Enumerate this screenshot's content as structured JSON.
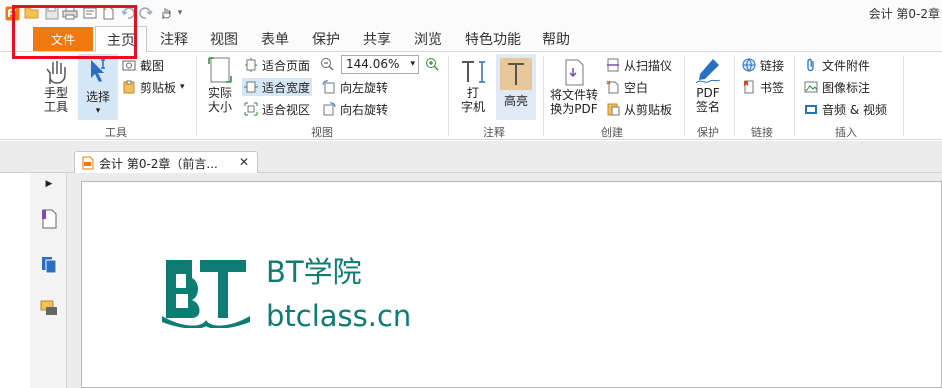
{
  "window": {
    "title": "会计 第0-2章"
  },
  "tabs": {
    "file": "文件",
    "home": "主页",
    "annotate": "注释",
    "view": "视图",
    "form": "表单",
    "protect": "保护",
    "share": "共享",
    "browse": "浏览",
    "features": "特色功能",
    "help": "帮助"
  },
  "ribbon": {
    "tools": {
      "group": "工具",
      "hand": "手型\n工具",
      "hand_l1": "手型",
      "hand_l2": "工具",
      "select": "选择",
      "screenshot": "截图",
      "clipboard": "剪贴板"
    },
    "view": {
      "group": "视图",
      "actual_l1": "实际",
      "actual_l2": "大小",
      "fit_page": "适合页面",
      "fit_width": "适合宽度",
      "fit_visible": "适合视区",
      "zoom": "144.06%",
      "rotate_left": "向左旋转",
      "rotate_right": "向右旋转"
    },
    "annotate": {
      "group": "注释",
      "typewriter_l1": "打",
      "typewriter_l2": "字机",
      "highlight": "高亮"
    },
    "create": {
      "group": "创建",
      "to_pdf_l1": "将文件转",
      "to_pdf_l2": "换为PDF",
      "from_scanner": "从扫描仪",
      "blank": "空白",
      "from_clipboard": "从剪贴板"
    },
    "protect": {
      "group": "保护",
      "sign_l1": "PDF",
      "sign_l2": "签名"
    },
    "links": {
      "group": "链接",
      "link": "链接",
      "bookmark": "书签"
    },
    "insert": {
      "group": "插入",
      "attachment": "文件附件",
      "image": "图像标注",
      "audio_video": "音频 & 视频"
    }
  },
  "document_tab": {
    "label": "会计 第0-2章（前言..."
  },
  "page_logo": {
    "line1": "BT学院",
    "line2": "btclass.cn"
  },
  "colors": {
    "accent": "#f0780e",
    "logo": "#0d7c72",
    "highlight_box": "#e8101c"
  }
}
